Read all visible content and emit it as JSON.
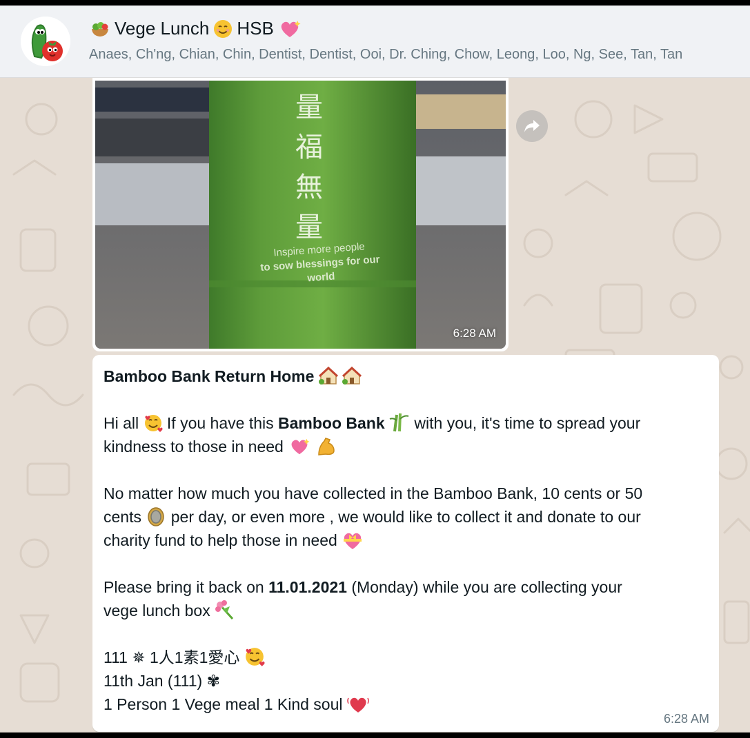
{
  "header": {
    "title": "Vege Lunch",
    "title_suffix": "HSB",
    "members": "Anaes, Ch'ng, Chian, Chin, Dentist, Dentist, Ooi, Dr. Ching, Chow, Leong, Loo, Ng, See, Tan, Tan"
  },
  "image_message": {
    "photo_lines": [
      "量",
      "福",
      "無",
      "量"
    ],
    "photo_caption_1": "Inspire more people",
    "photo_caption_2": "to sow blessings for our world",
    "time": "6:28 AM"
  },
  "text_message": {
    "title": "Bamboo Bank Return Home",
    "p1_a": "Hi all",
    "p1_b": "If you have this",
    "p1_bold": "Bamboo Bank",
    "p1_c": "with you, it's time to spread your",
    "p1_d": "kindness to those in need",
    "p2_a": "No matter how much you have collected in the Bamboo Bank, 10 cents or 50",
    "p2_b": "cents",
    "p2_c": "per day, or even more , we would like to collect it and donate to our",
    "p2_d": "charity fund to help those in need",
    "p3_a": "Please bring it back on",
    "p3_bold": "11.01.2021",
    "p3_b": "(Monday) while you are collecting your",
    "p3_c": "vege lunch box",
    "p4_a": "111 ✵ 1人1素1愛心",
    "p4_b": "11th Jan (111) ✾",
    "p4_c": "1 Person 1 Vege meal 1 Kind soul",
    "time": "6:28 AM"
  },
  "icons": {
    "forward": "forward-arrow-icon"
  },
  "colors": {
    "header_bg": "#f0f2f5",
    "wallpaper": "#e6ddd4",
    "bubble": "#ffffff",
    "meta_text": "#667781"
  }
}
